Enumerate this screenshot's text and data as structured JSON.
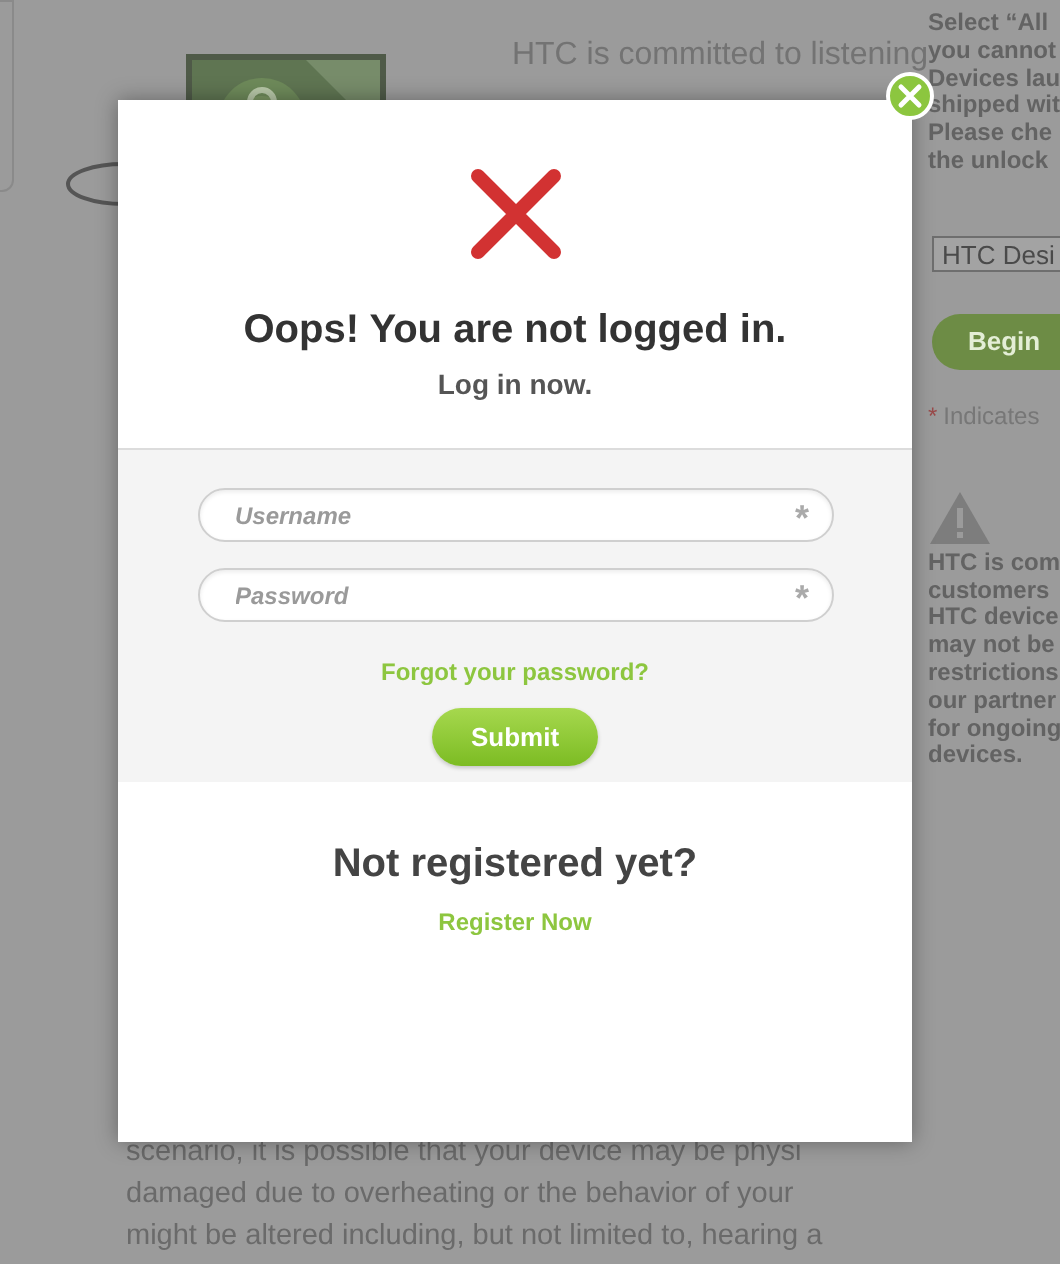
{
  "background": {
    "intro": [
      "HTC is committed to listening"
    ],
    "notice_lines": [
      "Select “All",
      "you cannot",
      "Devices lau",
      "shipped wit",
      "Please che",
      "the unlock"
    ],
    "device_select": "HTC Desi",
    "begin_button": "Begin",
    "required_mark": "*",
    "required_note": "Indicates",
    "warning_lines": [
      "HTC is com",
      "customers",
      "HTC device",
      "may not be",
      "restrictions",
      "our partner",
      "for ongoing",
      "devices."
    ],
    "body_lines": [
      "scenario, it is possible that your device may be physi",
      "damaged due to overheating or the behavior of your",
      "might be altered including, but not limited to, hearing a"
    ]
  },
  "dialog": {
    "title": "Oops! You are not logged in.",
    "subtitle": "Log in now.",
    "fields": [
      {
        "placeholder": "Username",
        "required_mark": "*"
      },
      {
        "placeholder": "Password",
        "required_mark": "*"
      }
    ],
    "forgot_link": "Forgot your password?",
    "submit": "Submit",
    "register_heading": "Not registered yet?",
    "register_link": "Register Now"
  }
}
